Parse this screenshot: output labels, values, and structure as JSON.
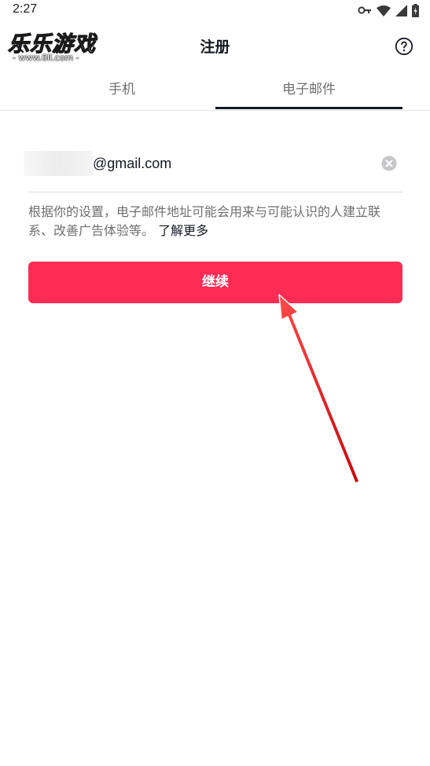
{
  "status_bar": {
    "time": "2:27",
    "icons": [
      "key-icon",
      "wifi-icon",
      "signal-icon",
      "battery-icon"
    ]
  },
  "watermark": {
    "main": "乐乐游戏",
    "sub": "- www.6ll.com -"
  },
  "header": {
    "title": "注册",
    "back_icon": "back-arrow-icon",
    "help_icon": "help-icon"
  },
  "tabs": [
    {
      "label": "手机",
      "selected": false
    },
    {
      "label": "电子邮件",
      "selected": true
    }
  ],
  "email_input": {
    "value": "@gmail.com",
    "clear_icon": "clear-icon"
  },
  "hint": {
    "text": "根据你的设置，电子邮件地址可能会用来与可能认识的人建立联系、改善广告体验等。",
    "link": "了解更多"
  },
  "continue_button": {
    "label": "继续"
  },
  "colors": {
    "accent": "#fe2c55",
    "text_primary": "#161823",
    "text_secondary": "#6f6f70",
    "annotation": "#e8161b"
  }
}
